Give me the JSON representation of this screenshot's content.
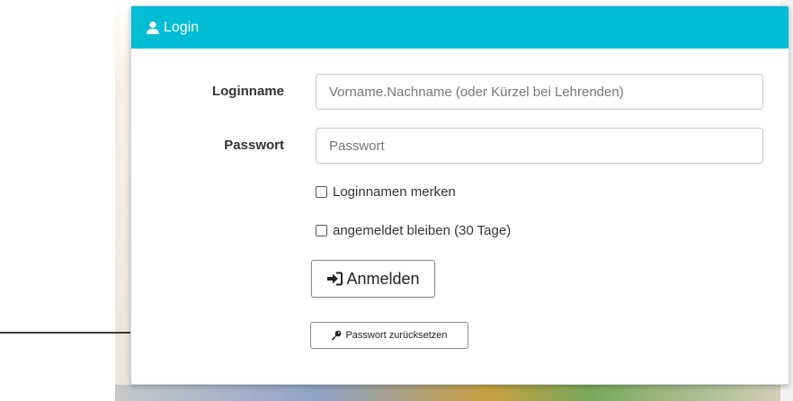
{
  "modal": {
    "title": "Login",
    "header_color": "#00bcd4"
  },
  "form": {
    "loginname_label": "Loginname",
    "loginname_placeholder": "Vorname.Nachname (oder Kürzel bei Lehrenden)",
    "password_label": "Passwort",
    "password_placeholder": "Passwort",
    "remember_name_label": "Loginnamen merken",
    "stay_logged_in_label": "angemeldet bleiben (30 Tage)",
    "login_button_label": "Anmelden",
    "reset_password_label": "Passwort zurücksetzen"
  },
  "icons": {
    "header": "user-icon",
    "login": "sign-in-icon",
    "reset": "key-icon"
  }
}
